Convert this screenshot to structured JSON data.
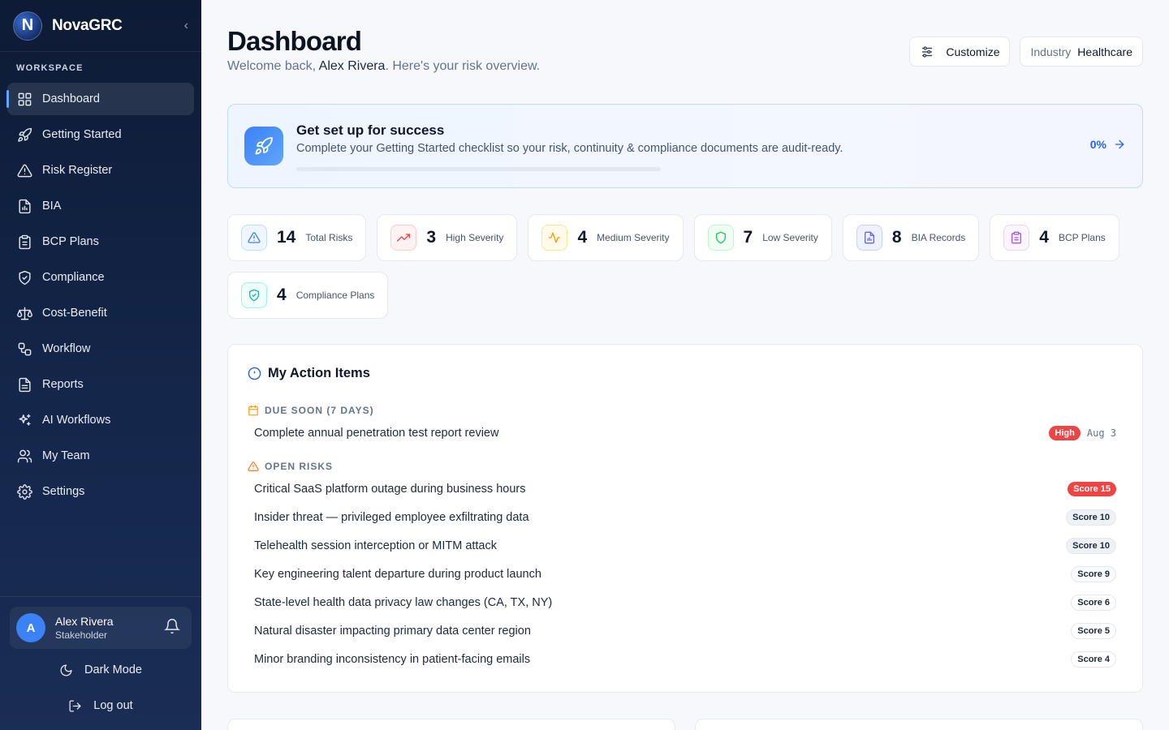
{
  "app": {
    "name": "NovaGRC",
    "logo_letter": "N"
  },
  "sidebar": {
    "section_label": "WORKSPACE",
    "items": [
      {
        "label": "Dashboard",
        "icon": "grid-icon",
        "active": true
      },
      {
        "label": "Getting Started",
        "icon": "rocket-icon"
      },
      {
        "label": "Risk Register",
        "icon": "warning-triangle-icon"
      },
      {
        "label": "BIA",
        "icon": "document-chart-icon"
      },
      {
        "label": "BCP Plans",
        "icon": "clipboard-icon"
      },
      {
        "label": "Compliance",
        "icon": "shield-check-icon"
      },
      {
        "label": "Cost-Benefit",
        "icon": "scale-icon"
      },
      {
        "label": "Workflow",
        "icon": "workflow-icon"
      },
      {
        "label": "Reports",
        "icon": "report-icon"
      },
      {
        "label": "AI Workflows",
        "icon": "sparkles-icon"
      },
      {
        "label": "My Team",
        "icon": "users-icon"
      },
      {
        "label": "Settings",
        "icon": "gear-icon"
      }
    ],
    "user": {
      "initial": "A",
      "name": "Alex Rivera",
      "role": "Stakeholder"
    },
    "dark_mode_label": "Dark Mode",
    "logout_label": "Log out"
  },
  "header": {
    "title": "Dashboard",
    "welcome_prefix": "Welcome back, ",
    "welcome_name": "Alex Rivera",
    "welcome_suffix": ". Here's your risk overview.",
    "customize_label": "Customize",
    "industry_label": "Industry",
    "industry_value": "Healthcare"
  },
  "setup": {
    "title": "Get set up for success",
    "description": "Complete your Getting Started checklist so your risk, continuity & compliance documents are audit-ready.",
    "progress_label": "0%",
    "progress": 0
  },
  "stats": [
    {
      "value": "14",
      "label": "Total Risks",
      "icon": "warning-triangle-icon",
      "color": "#3b82f6",
      "bg": "#eff6ff",
      "border": "#bfdbfe"
    },
    {
      "value": "3",
      "label": "High Severity",
      "icon": "trending-up-icon",
      "color": "#ef4444",
      "bg": "#fef2f2",
      "border": "#fecaca"
    },
    {
      "value": "4",
      "label": "Medium Severity",
      "icon": "activity-icon",
      "color": "#f59e0b",
      "bg": "#fffbeb",
      "border": "#fde68a"
    },
    {
      "value": "7",
      "label": "Low Severity",
      "icon": "shield-icon",
      "color": "#22c55e",
      "bg": "#f0fdf4",
      "border": "#bbf7d0"
    },
    {
      "value": "8",
      "label": "BIA Records",
      "icon": "document-chart-icon",
      "color": "#6366f1",
      "bg": "#eef2ff",
      "border": "#c7d2fe"
    },
    {
      "value": "4",
      "label": "BCP Plans",
      "icon": "clipboard-icon",
      "color": "#a855f7",
      "bg": "#faf5ff",
      "border": "#e9d5ff"
    },
    {
      "value": "4",
      "label": "Compliance Plans",
      "icon": "shield-check-icon",
      "color": "#14b8a6",
      "bg": "#f0fdfa",
      "border": "#99f6e4"
    }
  ],
  "action_items": {
    "title": "My Action Items",
    "due_soon_label": "DUE SOON (7 DAYS)",
    "due_soon": [
      {
        "text": "Complete annual penetration test report review",
        "badge": "High",
        "date": "Aug 3"
      }
    ],
    "open_risks_label": "OPEN RISKS",
    "open_risks": [
      {
        "text": "Critical SaaS platform outage during business hours",
        "badge": "Score 15",
        "style": "red"
      },
      {
        "text": "Insider threat — privileged employee exfiltrating data",
        "badge": "Score 10",
        "style": "gray"
      },
      {
        "text": "Telehealth session interception or MITM attack",
        "badge": "Score 10",
        "style": "gray"
      },
      {
        "text": "Key engineering talent departure during product launch",
        "badge": "Score 9",
        "style": "light"
      },
      {
        "text": "State-level health data privacy law changes (CA, TX, NY)",
        "badge": "Score 6",
        "style": "white"
      },
      {
        "text": "Natural disaster impacting primary data center region",
        "badge": "Score 5",
        "style": "white"
      },
      {
        "text": "Minor branding inconsistency in patient-facing emails",
        "badge": "Score 4",
        "style": "white"
      }
    ]
  }
}
